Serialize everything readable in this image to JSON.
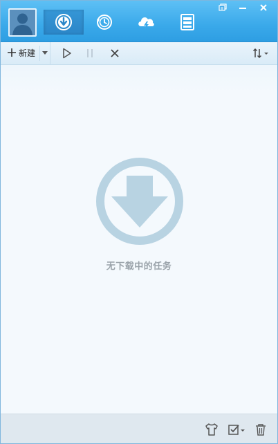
{
  "header": {
    "nav": [
      {
        "name": "downloading",
        "icon": "download-circle-icon",
        "active": true
      },
      {
        "name": "history",
        "icon": "history-clock-icon",
        "active": false
      },
      {
        "name": "cloud",
        "icon": "cloud-lightning-icon",
        "active": false
      },
      {
        "name": "files",
        "icon": "file-cabinet-icon",
        "active": false
      }
    ],
    "window_controls": [
      "restore-icon",
      "minimize-icon",
      "close-icon"
    ]
  },
  "toolbar": {
    "new_label": "新建"
  },
  "content": {
    "empty_text": "无下载中的任务"
  },
  "colors": {
    "header_blue": "#3aa9ea",
    "empty_icon": "#b8d3e2"
  }
}
